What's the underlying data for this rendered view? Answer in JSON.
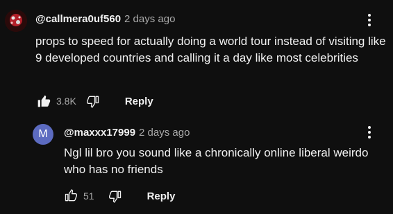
{
  "comments": [
    {
      "handle": "@callmera0uf560",
      "time": "2 days ago",
      "text": "props to speed for actually doing a world tour instead of visiting like 9 developed countries and calling it a day like most celebrities",
      "likes": "3.8K",
      "reply_label": "Reply",
      "avatar_icon": "profile-photo"
    },
    {
      "handle": "@maxxx17999",
      "time": "2 days ago",
      "text": "Ngl lil bro you sound like a chronically online liberal weirdo who has no friends",
      "likes": "51",
      "reply_label": "Reply",
      "avatar_letter": "M",
      "avatar_color": "#5c6bc0"
    }
  ],
  "colors": {
    "background": "#0f0f0f",
    "text_primary": "#f1f1f1",
    "text_secondary": "#aaaaaa"
  }
}
